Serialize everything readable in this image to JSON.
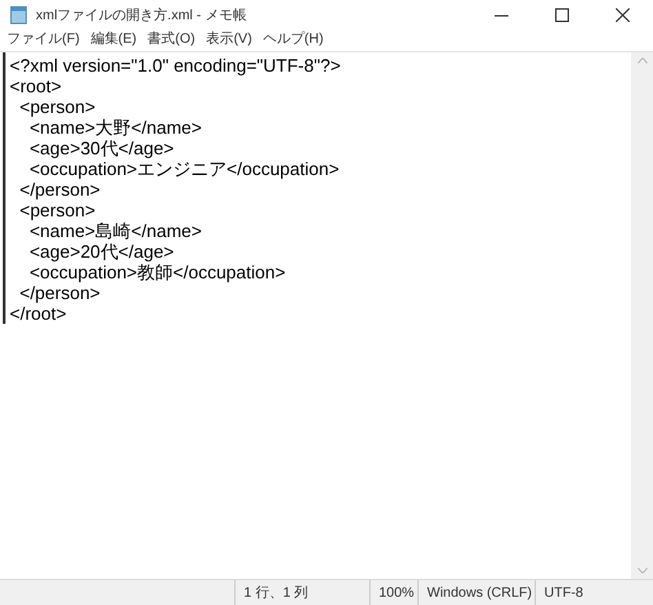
{
  "window": {
    "title": "xmlファイルの開き方.xml - メモ帳"
  },
  "menu": [
    "ファイル(F)",
    "編集(E)",
    "書式(O)",
    "表示(V)",
    "ヘルプ(H)"
  ],
  "editor": {
    "lines": [
      "<?xml version=\"1.0\" encoding=\"UTF-8\"?>",
      "<root>",
      "  <person>",
      "    <name>大野</name>",
      "    <age>30代</age>",
      "    <occupation>エンジニア</occupation>",
      "  </person>",
      "  <person>",
      "    <name>島崎</name>",
      "    <age>20代</age>",
      "    <occupation>教師</occupation>",
      "  </person>",
      "</root>"
    ]
  },
  "status_bar": [
    "1 行、1 列",
    "100%",
    "Windows (CRLF)",
    "UTF-8"
  ]
}
